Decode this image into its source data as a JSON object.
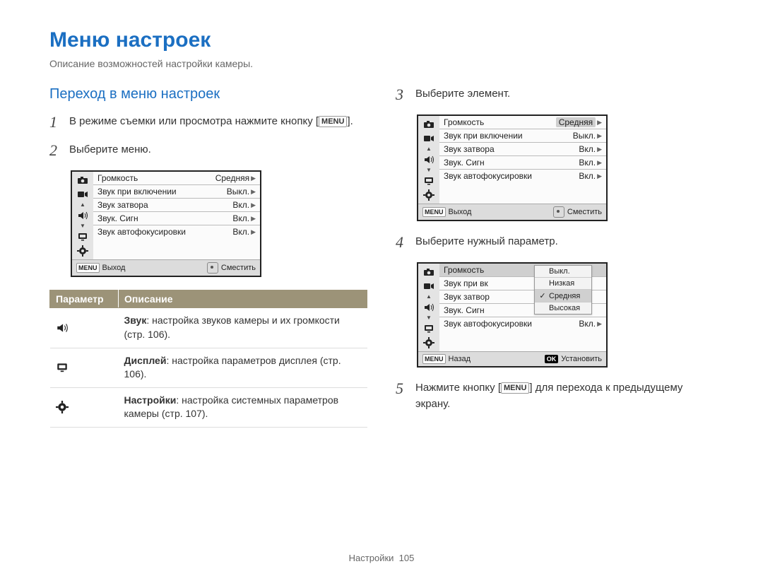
{
  "page_title": "Меню настроек",
  "page_subtitle": "Описание возможностей настройки камеры.",
  "section_title": "Переход в меню настроек",
  "menu_label": "MENU",
  "steps": {
    "s1a": "В режиме съемки или просмотра нажмите кнопку",
    "s1b": ".",
    "s2": "Выберите меню.",
    "s3": "Выберите элемент.",
    "s4": "Выберите нужный параметр.",
    "s5a": "Нажмите кнопку [",
    "s5b": "] для перехода к предыдущему экрану."
  },
  "lcd_common": {
    "rows": [
      {
        "label": "Громкость",
        "value": "Средняя"
      },
      {
        "label": "Звук при включении",
        "value": "Выкл."
      },
      {
        "label": "Звук затвора",
        "value": "Вкл."
      },
      {
        "label": "Звук. Сигн",
        "value": "Вкл."
      },
      {
        "label": "Звук автофокусировки",
        "value": "Вкл."
      }
    ],
    "exit": "Выход",
    "move": "Сместить",
    "back": "Назад",
    "set": "Установить"
  },
  "lcd4": {
    "rows_short": [
      {
        "label": "Громкость"
      },
      {
        "label": "Звук при вк"
      },
      {
        "label": "Звук затвор"
      },
      {
        "label": "Звук. Сигн"
      },
      {
        "label": "Звук автофокусировки",
        "value": "Вкл."
      }
    ],
    "options": [
      "Выкл.",
      "Низкая",
      "Средняя",
      "Высокая"
    ],
    "selected_index": 2
  },
  "param_table": {
    "headers": [
      "Параметр",
      "Описание"
    ],
    "rows": [
      {
        "icon": "sound",
        "bold": "Звук",
        "rest": ": настройка звуков камеры и их громкости (стр. 106)."
      },
      {
        "icon": "display",
        "bold": "Дисплей",
        "rest": ": настройка параметров дисплея (стр. 106)."
      },
      {
        "icon": "gear",
        "bold": "Настройки",
        "rest": ": настройка системных параметров камеры (стр. 107)."
      }
    ]
  },
  "footer": {
    "label": "Настройки",
    "page": "105"
  }
}
